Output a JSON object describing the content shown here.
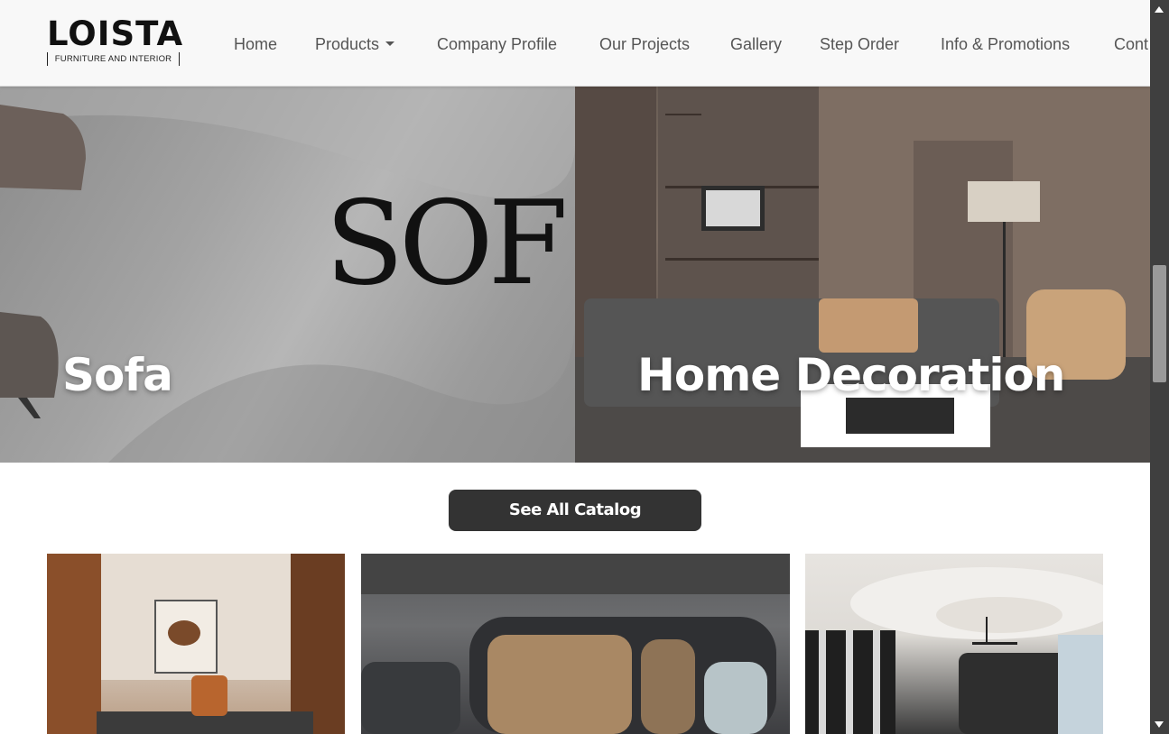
{
  "brand": {
    "name": "LOISTA",
    "tagline": "FURNITURE AND INTERIOR"
  },
  "nav": {
    "items": [
      {
        "label": "Home"
      },
      {
        "label": "Products",
        "has_dropdown": true
      },
      {
        "label": "Company Profile"
      },
      {
        "label": "Our Projects"
      },
      {
        "label": "Gallery"
      },
      {
        "label": "Step Order"
      },
      {
        "label": "Info & Promotions"
      },
      {
        "label": "Cont"
      }
    ]
  },
  "hero": {
    "tiles": [
      {
        "label": "Sofa",
        "image_text": "SOF"
      },
      {
        "label": "Home Decoration"
      }
    ]
  },
  "catalog_button": {
    "label": "See All Catalog"
  },
  "colors": {
    "button_bg": "#333333",
    "nav_text": "#555555",
    "navbar_bg": "#f8f8f8"
  }
}
